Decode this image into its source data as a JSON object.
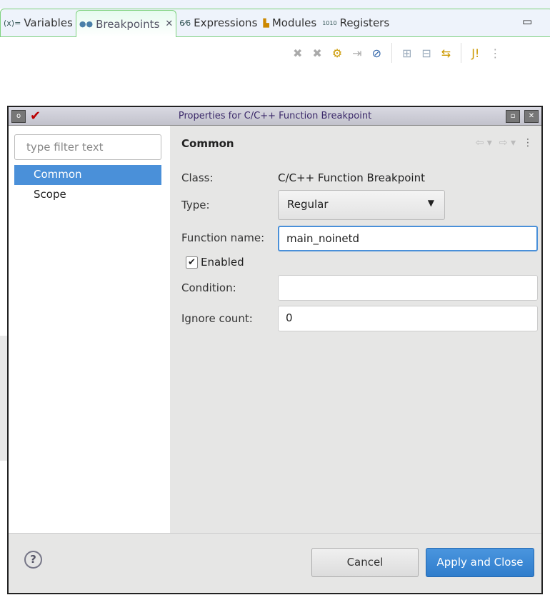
{
  "tabs": [
    {
      "label": "Variables",
      "icon": "(x)="
    },
    {
      "label": "Breakpoints",
      "icon": "●●"
    },
    {
      "label": "Expressions",
      "icon": "6⁄6"
    },
    {
      "label": "Modules",
      "icon": "▙"
    },
    {
      "label": "Registers",
      "icon": "1010"
    }
  ],
  "dialog": {
    "title": "Properties for C/C++ Function Breakpoint",
    "filter_placeholder": "type filter text",
    "nav": [
      "Common",
      "Scope"
    ],
    "section_title": "Common",
    "class_label": "Class:",
    "class_value": "C/C++ Function Breakpoint",
    "type_label": "Type:",
    "type_value": "Regular",
    "function_label": "Function name:",
    "function_value": "main_noinetd",
    "enabled_label": "Enabled",
    "enabled": true,
    "condition_label": "Condition:",
    "condition_value": "",
    "ignore_label": "Ignore count:",
    "ignore_value": "0",
    "cancel": "Cancel",
    "apply": "Apply and Close"
  },
  "colors": {
    "accent": "#4a90d9",
    "tab_border": "#7fd27f"
  }
}
